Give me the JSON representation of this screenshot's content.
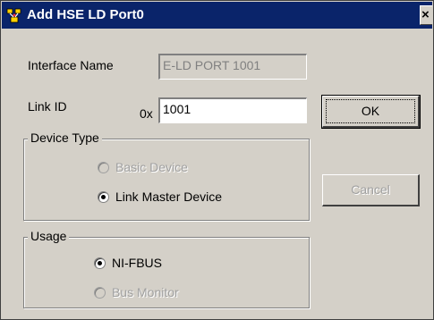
{
  "window": {
    "title": "Add HSE LD Port0",
    "close_glyph": "×",
    "title_icon": "hse-port-icon"
  },
  "form": {
    "interface_name": {
      "label": "Interface Name",
      "value": "E-LD PORT 1001"
    },
    "link_id": {
      "label": "Link ID",
      "prefix": "0x",
      "value": "1001"
    }
  },
  "device_type": {
    "title": "Device Type",
    "options": [
      {
        "label": "Basic Device",
        "selected": false,
        "enabled": false
      },
      {
        "label": "Link Master Device",
        "selected": true,
        "enabled": true
      }
    ]
  },
  "usage": {
    "title": "Usage",
    "options": [
      {
        "label": "NI-FBUS",
        "selected": true,
        "enabled": true
      },
      {
        "label": "Bus Monitor",
        "selected": false,
        "enabled": false
      }
    ]
  },
  "buttons": {
    "ok_label": "OK",
    "cancel_label": "Cancel"
  },
  "colors": {
    "titlebar": "#0a246a",
    "face": "#d4d0c8",
    "disabled_text": "#a0a0a0"
  }
}
